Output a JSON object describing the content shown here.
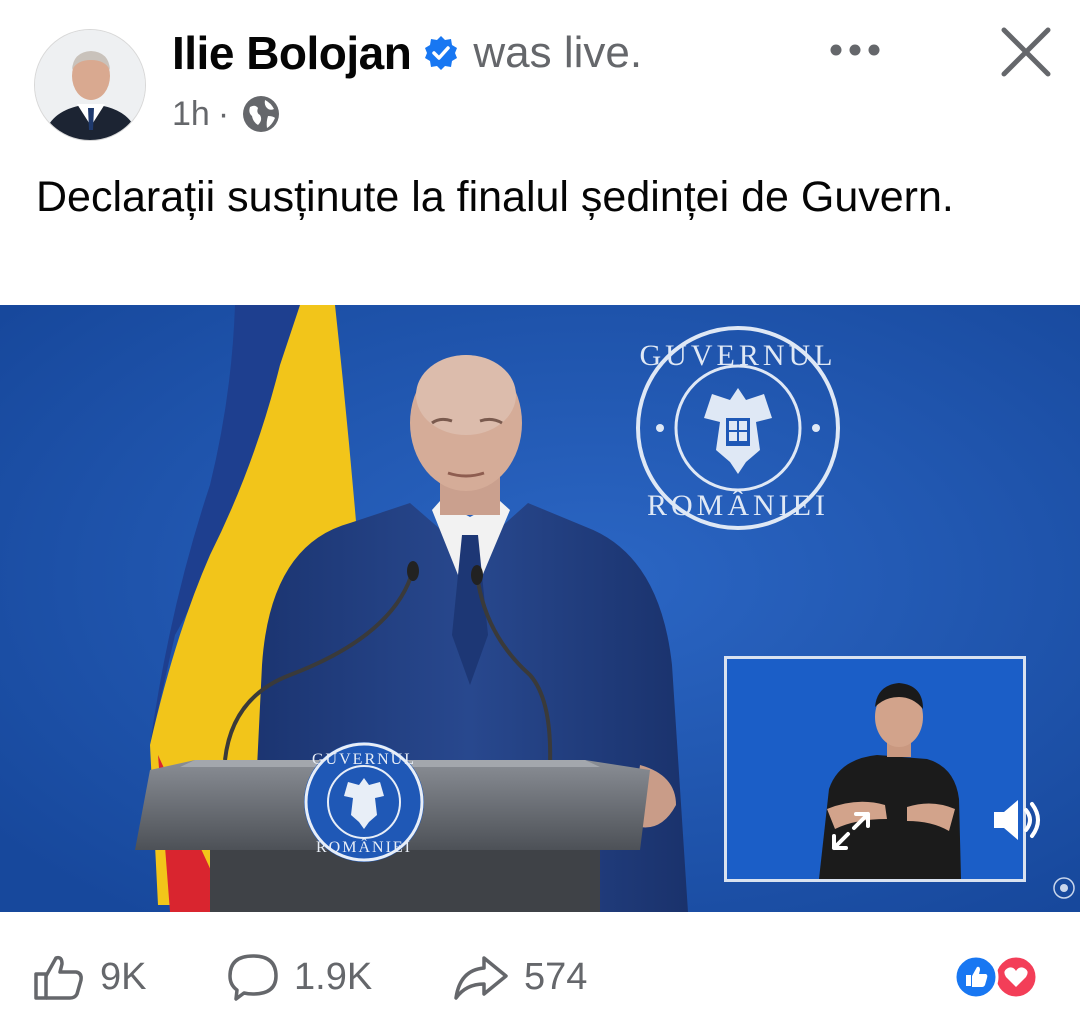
{
  "post": {
    "author_name": "Ilie Bolojan",
    "status_text": "was live.",
    "timestamp": "1h",
    "separator": "·",
    "audience_icon": "globe-icon",
    "verified_icon": "verified-badge-icon",
    "more_icon": "more-options-icon",
    "close_icon": "close-icon",
    "text": "Declarații susținute la finalul ședinței de Guvern."
  },
  "video": {
    "seal_text_top": "GUVERNUL",
    "seal_text_bottom": "ROMÂNIEI",
    "volume_icon": "volume-icon",
    "expand_icon": "expand-icon"
  },
  "stats": {
    "likes": "9K",
    "comments": "1.9K",
    "shares": "574",
    "like_icon": "thumbs-up-icon",
    "comment_icon": "comment-icon",
    "share_icon": "share-icon",
    "reaction_icons": [
      "like-reaction-icon",
      "love-reaction-icon"
    ]
  },
  "colors": {
    "verified_blue": "#1877f2",
    "secondary_text": "#65676b",
    "background_blue": "#1f58b6",
    "love_red": "#f33e58"
  }
}
